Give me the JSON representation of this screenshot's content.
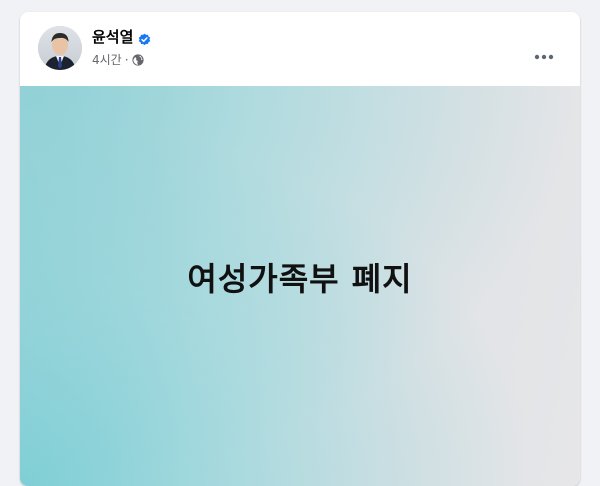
{
  "post": {
    "author": "윤석열",
    "time": "4시간",
    "separator": "·",
    "body_text": "여성가족부 폐지"
  },
  "icons": {
    "verified": "verified-badge-icon",
    "audience": "globe-icon",
    "more": "more-options-icon"
  },
  "colors": {
    "verified_blue": "#1877f2",
    "meta_gray": "#65676b",
    "text_dark": "#050505"
  }
}
